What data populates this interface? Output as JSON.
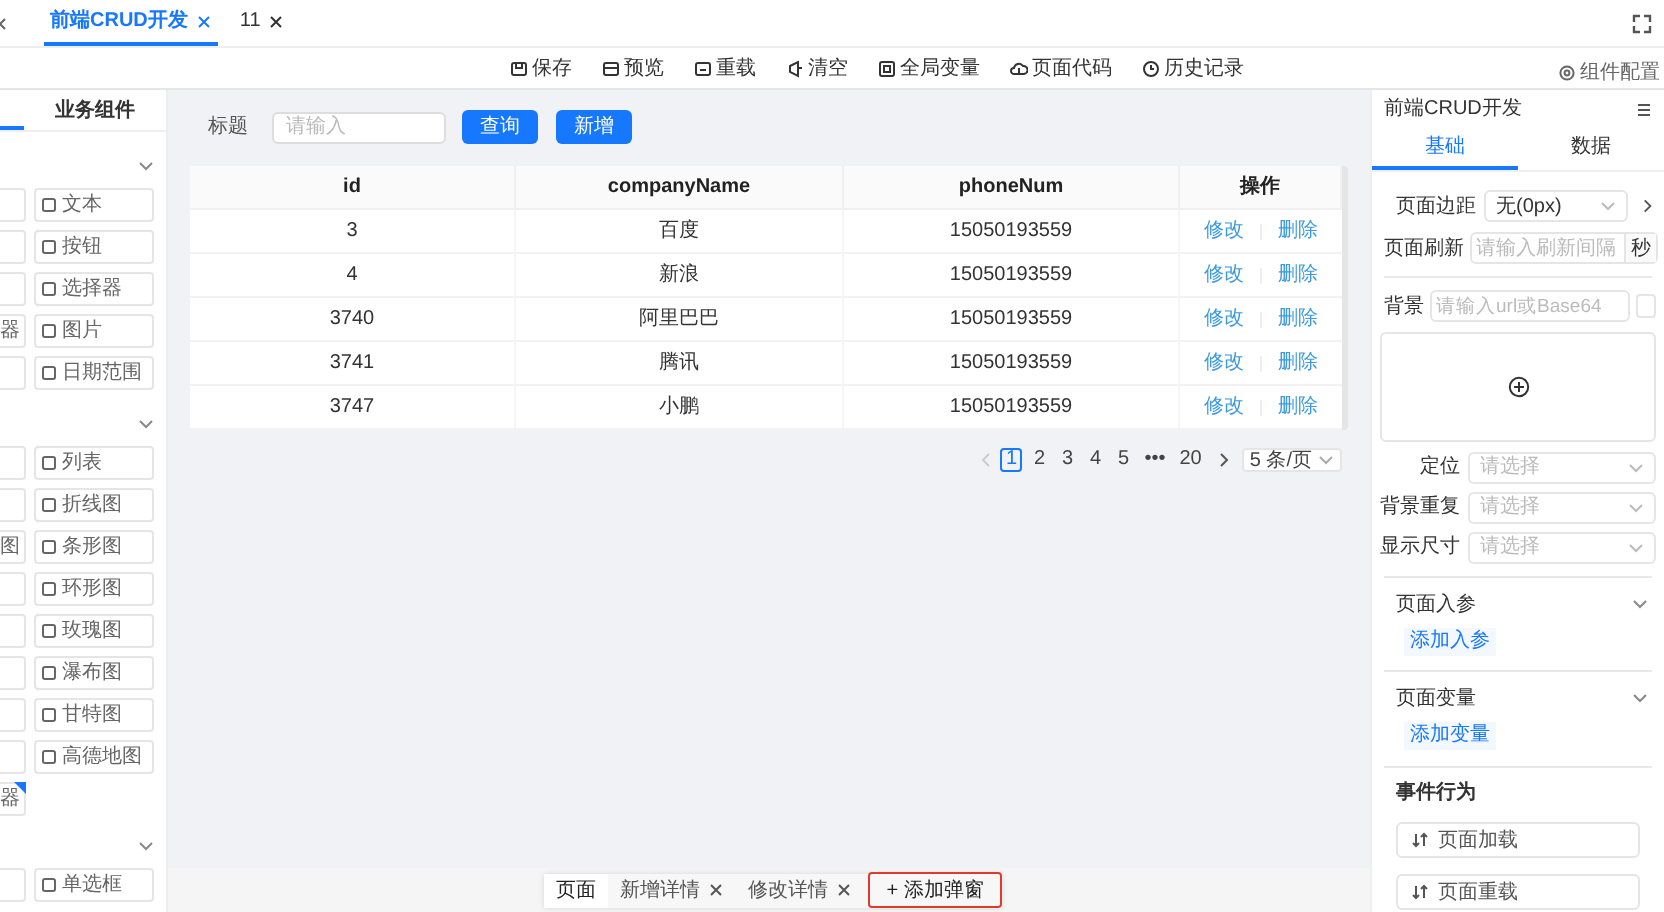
{
  "tabs": [
    {
      "label": "前端CRUD开发",
      "selected": true
    },
    {
      "label": "11",
      "selected": false
    }
  ],
  "toolbar": [
    "保存",
    "预览",
    "重载",
    "清空",
    "全局变量",
    "页面代码",
    "历史记录"
  ],
  "config_button": "组件配置",
  "palette": {
    "tabs": [
      {
        "label": "业务组件",
        "selected": false
      }
    ],
    "sections": [
      {
        "expanded": true,
        "items": [
          {
            "right": "文本"
          },
          {
            "right": "按钮"
          },
          {
            "right": "选择器"
          },
          {
            "left": "器",
            "right": "图片"
          },
          {
            "right": "日期范围"
          }
        ]
      },
      {
        "expanded": true,
        "items": [
          {
            "right": "列表"
          },
          {
            "right": "折线图"
          },
          {
            "left": "图",
            "right": "条形图"
          },
          {
            "right": "环形图"
          },
          {
            "right": "玫瑰图"
          },
          {
            "right": "瀑布图"
          },
          {
            "right": "甘特图"
          },
          {
            "right": "高德地图"
          },
          {
            "left": "器"
          }
        ]
      },
      {
        "expanded": true,
        "items": [
          {
            "right": "单选框"
          }
        ]
      }
    ]
  },
  "filter": {
    "label": "标题",
    "placeholder": "请输入",
    "buttons": [
      "查询",
      "新增"
    ]
  },
  "table": {
    "columns": [
      "id",
      "companyName",
      "phoneNum",
      "操作"
    ],
    "rows": [
      {
        "cells": [
          "3",
          "百度",
          "15050193559"
        ],
        "actions": [
          "修改",
          "删除"
        ]
      },
      {
        "cells": [
          "4",
          "新浪",
          "15050193559"
        ],
        "actions": [
          "修改",
          "删除"
        ]
      },
      {
        "cells": [
          "3740",
          "阿里巴巴",
          "15050193559"
        ],
        "actions": [
          "修改",
          "删除"
        ]
      },
      {
        "cells": [
          "3741",
          "腾讯",
          "15050193559"
        ],
        "actions": [
          "修改",
          "删除"
        ]
      },
      {
        "cells": [
          "3747",
          "小鹏",
          "15050193559"
        ],
        "actions": [
          "修改",
          "删除"
        ]
      }
    ]
  },
  "pagination": {
    "pages": [
      {
        "label": "1",
        "selected": true
      },
      {
        "label": "2",
        "selected": false
      },
      {
        "label": "3",
        "selected": false
      },
      {
        "label": "4",
        "selected": false
      },
      {
        "label": "5",
        "selected": false
      },
      {
        "label": "•••",
        "selected": false
      },
      {
        "label": "20",
        "selected": false
      }
    ],
    "page_size": "5 条/页"
  },
  "bottom_tabs": [
    {
      "label": "页面",
      "selected": true,
      "closable": false
    },
    {
      "label": "新增详情",
      "selected": false,
      "closable": true
    },
    {
      "label": "修改详情",
      "selected": false,
      "closable": true
    }
  ],
  "add_dialog": "+ 添加弹窗",
  "panel": {
    "title": "前端CRUD开发",
    "tabs": [
      {
        "label": "基础",
        "selected": true
      },
      {
        "label": "数据",
        "selected": false
      }
    ],
    "margin": {
      "label": "页面边距",
      "value": "无(0px)"
    },
    "refresh": {
      "label": "页面刷新",
      "placeholder": "请输入刷新间隔",
      "unit": "秒"
    },
    "background": {
      "label": "背景",
      "placeholder": "请输入url或Base64"
    },
    "selects": [
      {
        "label": "定位",
        "placeholder": "请选择"
      },
      {
        "label": "背景重复",
        "placeholder": "请选择"
      },
      {
        "label": "显示尺寸",
        "placeholder": "请选择"
      }
    ],
    "sections": [
      {
        "title": "页面入参",
        "link": "添加入参"
      },
      {
        "title": "页面变量",
        "link": "添加变量"
      }
    ],
    "events": {
      "title": "事件行为",
      "items": [
        "页面加载",
        "页面重载"
      ]
    }
  }
}
